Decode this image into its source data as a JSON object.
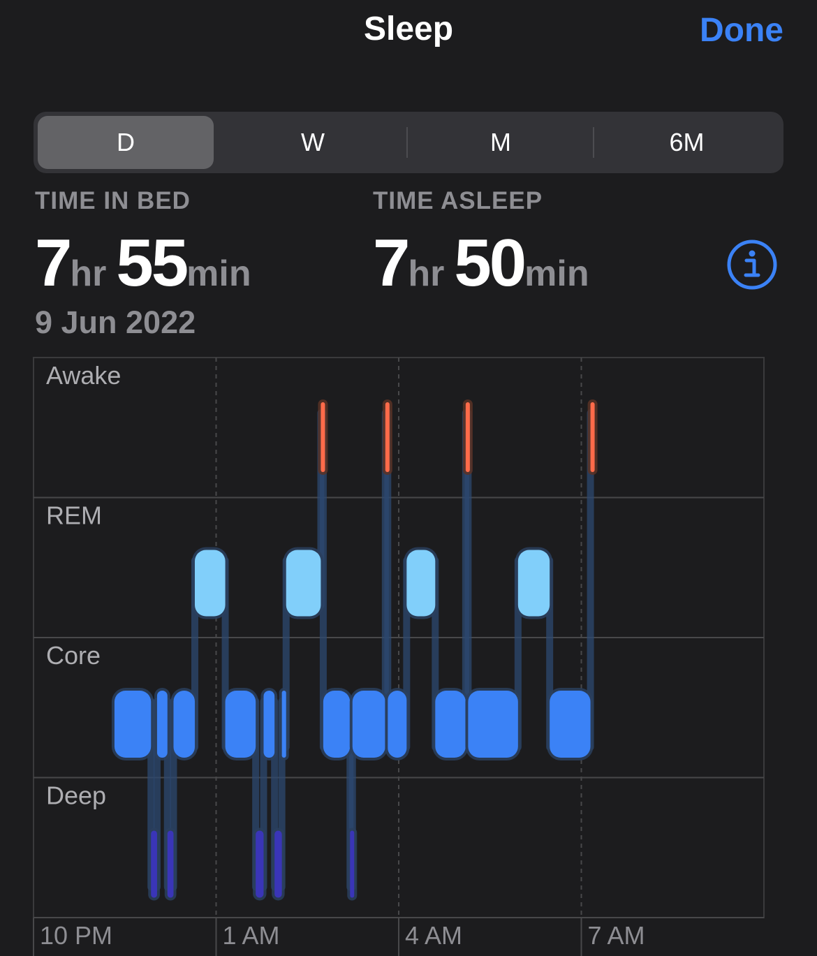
{
  "header": {
    "title": "Sleep",
    "done_label": "Done"
  },
  "segments": [
    {
      "label": "D",
      "active": true
    },
    {
      "label": "W",
      "active": false
    },
    {
      "label": "M",
      "active": false
    },
    {
      "label": "6M",
      "active": false
    }
  ],
  "stats": {
    "time_in_bed": {
      "label": "TIME IN BED",
      "hours": "7",
      "hours_unit": "hr",
      "minutes": "55",
      "minutes_unit": "min"
    },
    "time_asleep": {
      "label": "TIME ASLEEP",
      "hours": "7",
      "hours_unit": "hr",
      "minutes": "50",
      "minutes_unit": "min"
    },
    "date": "9 Jun 2022"
  },
  "icons": {
    "info": "info-circle-icon"
  },
  "colors": {
    "background": "#1c1c1e",
    "accent": "#3b82f6",
    "awake": "#ff6b4a",
    "rem": "#81cffa",
    "core": "#3b82f6",
    "deep": "#3a35b8"
  },
  "chart_data": {
    "type": "sleep-stages",
    "stages": [
      "Awake",
      "REM",
      "Core",
      "Deep"
    ],
    "x_ticks": [
      {
        "label": "10 PM",
        "h": 0
      },
      {
        "label": "1 AM",
        "h": 3
      },
      {
        "label": "4 AM",
        "h": 6
      },
      {
        "label": "7 AM",
        "h": 9
      }
    ],
    "x_range_hours": [
      0,
      12
    ],
    "segments": [
      {
        "stage": "Core",
        "start": 1.33,
        "end": 1.93
      },
      {
        "stage": "Deep",
        "start": 1.93,
        "end": 2.03
      },
      {
        "stage": "Core",
        "start": 2.03,
        "end": 2.2
      },
      {
        "stage": "Deep",
        "start": 2.2,
        "end": 2.3
      },
      {
        "stage": "Core",
        "start": 2.3,
        "end": 2.65
      },
      {
        "stage": "REM",
        "start": 2.65,
        "end": 3.15
      },
      {
        "stage": "Core",
        "start": 3.15,
        "end": 3.65
      },
      {
        "stage": "Deep",
        "start": 3.65,
        "end": 3.78
      },
      {
        "stage": "Core",
        "start": 3.78,
        "end": 3.96
      },
      {
        "stage": "Deep",
        "start": 3.96,
        "end": 4.08
      },
      {
        "stage": "Core",
        "start": 4.08,
        "end": 4.15
      },
      {
        "stage": "REM",
        "start": 4.15,
        "end": 4.72
      },
      {
        "stage": "Awake",
        "start": 4.72,
        "end": 4.76
      },
      {
        "stage": "Core",
        "start": 4.76,
        "end": 5.2
      },
      {
        "stage": "Deep",
        "start": 5.2,
        "end": 5.24
      },
      {
        "stage": "Core",
        "start": 5.24,
        "end": 5.78
      },
      {
        "stage": "Awake",
        "start": 5.78,
        "end": 5.82
      },
      {
        "stage": "Core",
        "start": 5.82,
        "end": 6.13
      },
      {
        "stage": "REM",
        "start": 6.13,
        "end": 6.6
      },
      {
        "stage": "Core",
        "start": 6.6,
        "end": 7.1
      },
      {
        "stage": "Awake",
        "start": 7.1,
        "end": 7.14
      },
      {
        "stage": "Core",
        "start": 7.14,
        "end": 7.96
      },
      {
        "stage": "REM",
        "start": 7.96,
        "end": 8.48
      },
      {
        "stage": "Core",
        "start": 8.48,
        "end": 9.15
      },
      {
        "stage": "Awake",
        "start": 9.15,
        "end": 9.19
      }
    ]
  }
}
